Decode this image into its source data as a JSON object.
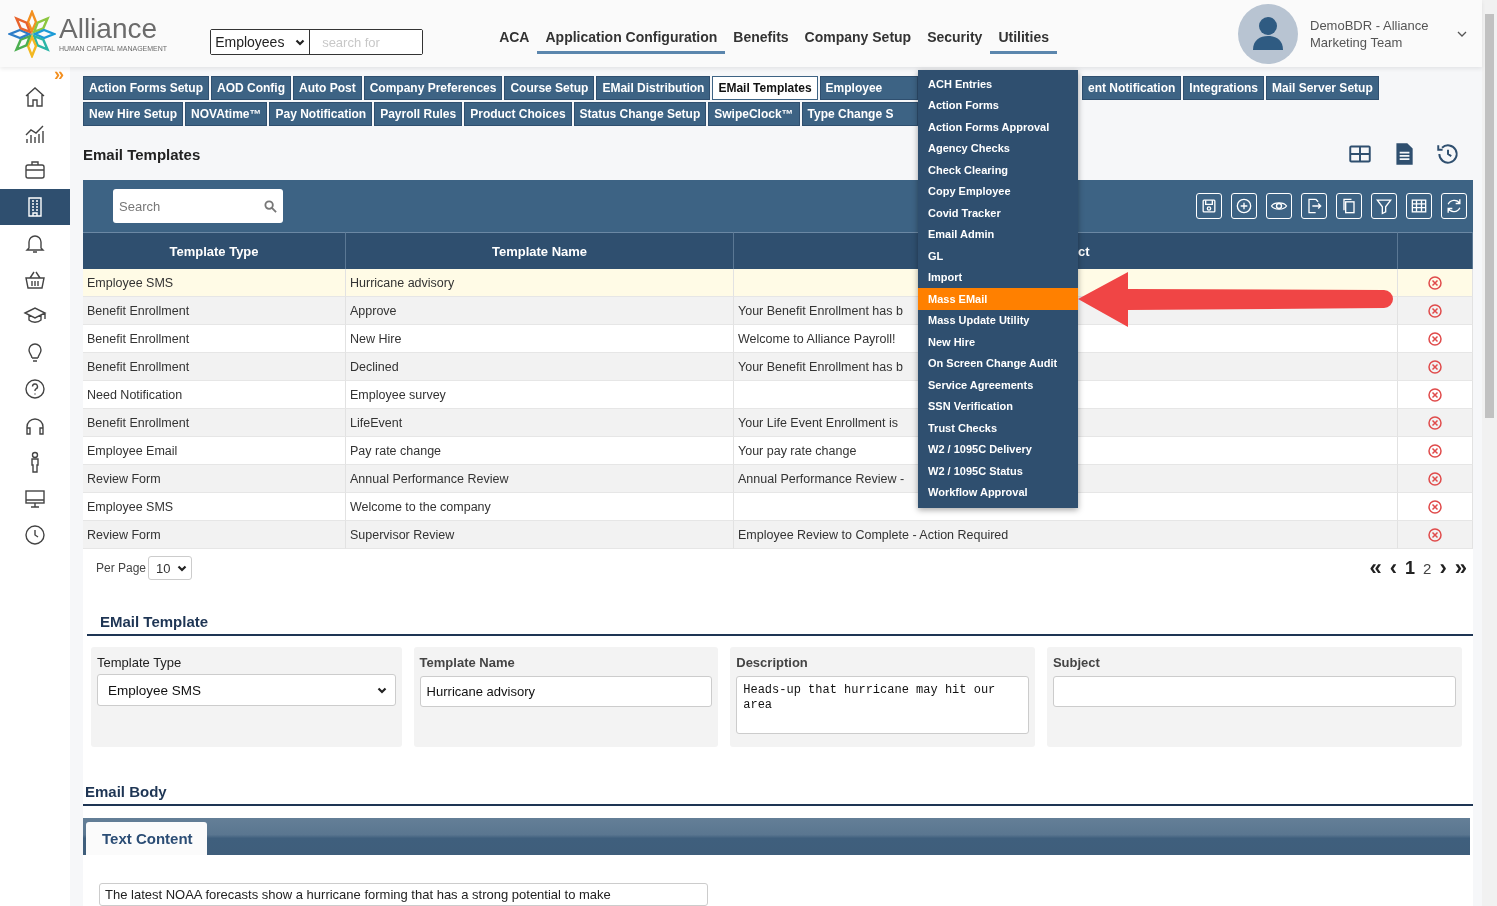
{
  "header": {
    "logo": {
      "name": "Alliance",
      "tagline": "HUMAN CAPITAL MANAGEMENT"
    },
    "search": {
      "scope": "Employees",
      "placeholder": "search for"
    },
    "nav": [
      {
        "label": "ACA",
        "active": false
      },
      {
        "label": "Application Configuration",
        "active": true
      },
      {
        "label": "Benefits",
        "active": false
      },
      {
        "label": "Company Setup",
        "active": false
      },
      {
        "label": "Security",
        "active": false
      },
      {
        "label": "Utilities",
        "active": true
      }
    ],
    "user": {
      "name": "DemoBDR - Alliance",
      "team": "Marketing Team"
    }
  },
  "sidebar": {
    "expand": "»",
    "items": [
      {
        "kind": "home",
        "selected": false
      },
      {
        "kind": "chart",
        "selected": false
      },
      {
        "kind": "briefcase",
        "selected": false
      },
      {
        "kind": "building",
        "selected": true
      },
      {
        "kind": "bell",
        "selected": false
      },
      {
        "kind": "basket",
        "selected": false
      },
      {
        "kind": "cap",
        "selected": false
      },
      {
        "kind": "bulb",
        "selected": false
      },
      {
        "kind": "help",
        "selected": false
      },
      {
        "kind": "headset",
        "selected": false
      },
      {
        "kind": "person",
        "selected": false
      },
      {
        "kind": "monitor",
        "selected": false
      },
      {
        "kind": "clock",
        "selected": false
      }
    ]
  },
  "tab_rows": [
    {
      "tabs": [
        {
          "label": "Action Forms Setup",
          "selected": false
        },
        {
          "label": "AOD Config",
          "selected": false
        },
        {
          "label": "Auto Post",
          "selected": false
        },
        {
          "label": "Company Preferences",
          "selected": false
        },
        {
          "label": "Course Setup",
          "selected": false
        },
        {
          "label": "EMail Distribution",
          "selected": false
        },
        {
          "label": "EMail Templates",
          "selected": true
        },
        {
          "label": "Employee",
          "selected": false
        }
      ],
      "tabs_after_menu": [
        {
          "label": "ent Notification",
          "selected": false
        },
        {
          "label": "Integrations",
          "selected": false
        },
        {
          "label": "Mail Server Setup",
          "selected": false
        }
      ]
    },
    {
      "tabs": [
        {
          "label": "New Hire Setup",
          "selected": false
        },
        {
          "label": "NOVAtime™",
          "selected": false
        },
        {
          "label": "Pay Notification",
          "selected": false
        },
        {
          "label": "Payroll Rules",
          "selected": false
        },
        {
          "label": "Product Choices",
          "selected": false
        },
        {
          "label": "Status Change Setup",
          "selected": false
        },
        {
          "label": "SwipeClock™",
          "selected": false
        },
        {
          "label": "Type Change S",
          "selected": false
        }
      ]
    }
  ],
  "utilities_menu": {
    "items": [
      {
        "label": "ACH Entries",
        "selected": false
      },
      {
        "label": "Action Forms",
        "selected": false
      },
      {
        "label": "Action Forms Approval",
        "selected": false
      },
      {
        "label": "Agency Checks",
        "selected": false
      },
      {
        "label": "Check Clearing",
        "selected": false
      },
      {
        "label": "Copy Employee",
        "selected": false
      },
      {
        "label": "Covid Tracker",
        "selected": false
      },
      {
        "label": "Email Admin",
        "selected": false
      },
      {
        "label": "GL",
        "selected": false
      },
      {
        "label": "Import",
        "selected": false
      },
      {
        "label": "Mass EMail",
        "selected": true
      },
      {
        "label": "Mass Update Utility",
        "selected": false
      },
      {
        "label": "New Hire",
        "selected": false
      },
      {
        "label": "On Screen Change Audit",
        "selected": false
      },
      {
        "label": "Service Agreements",
        "selected": false
      },
      {
        "label": "SSN Verification",
        "selected": false
      },
      {
        "label": "Trust Checks",
        "selected": false
      },
      {
        "label": "W2 / 1095C Delivery",
        "selected": false
      },
      {
        "label": "W2 / 1095C Status",
        "selected": false
      },
      {
        "label": "Workflow Approval",
        "selected": false
      }
    ]
  },
  "page": {
    "title": "Email Templates"
  },
  "grid": {
    "search_placeholder": "Search",
    "columns": [
      "Template Type",
      "Template Name",
      "ct"
    ],
    "rows": [
      {
        "type": "Employee SMS",
        "name": "Hurricane advisory",
        "selected": true
      },
      {
        "type": "Benefit Enrollment",
        "name": "Approve",
        "column_3": "Your Benefit Enrollment has b",
        "selected": false
      },
      {
        "type": "Benefit Enrollment",
        "name": "New Hire",
        "column_3": "Welcome to Alliance Payroll!",
        "selected": false
      },
      {
        "type": "Benefit Enrollment",
        "name": "Declined",
        "column_3": "Your Benefit Enrollment has b",
        "selected": false
      },
      {
        "type": "Need Notification",
        "name": "Employee survey",
        "selected": false
      },
      {
        "type": "Benefit Enrollment",
        "name": "LifeEvent",
        "column_3": "Your Life Event Enrollment is",
        "selected": false
      },
      {
        "type": "Employee Email",
        "name": "Pay rate change",
        "column_3": "Your pay rate change",
        "selected": false
      },
      {
        "type": "Review Form",
        "name": "Annual Performance Review",
        "column_3": "Annual Performance Review -",
        "selected": false
      },
      {
        "type": "Employee SMS",
        "name": "Welcome to the company",
        "selected": false
      },
      {
        "type": "Review Form",
        "name": "Supervisor Review",
        "column_3": "Employee Review to Complete - Action Required",
        "selected": false
      }
    ],
    "per_page_label": "Per Page",
    "per_page": "10",
    "first": "«",
    "prev": "‹",
    "next": "›",
    "last": "»",
    "pages": [
      {
        "label": "1",
        "selected": true
      },
      {
        "label": "2",
        "selected": false
      }
    ]
  },
  "form": {
    "title": "EMail Template",
    "fields": [
      {
        "kind": "select",
        "label": "Template Type",
        "value": "Employee SMS"
      },
      {
        "kind": "input",
        "label": "Template Name",
        "value": "Hurricane advisory"
      },
      {
        "kind": "textarea",
        "label": "Description",
        "value": "Heads-up that hurricane may hit our area"
      },
      {
        "kind": "input",
        "label": "Subject"
      }
    ]
  },
  "body": {
    "title": "Email Body",
    "tabs": [
      {
        "label": "Text Content",
        "selected": true
      }
    ],
    "text": "The latest NOAA forecasts show a hurricane forming that has a strong potential to make"
  }
}
